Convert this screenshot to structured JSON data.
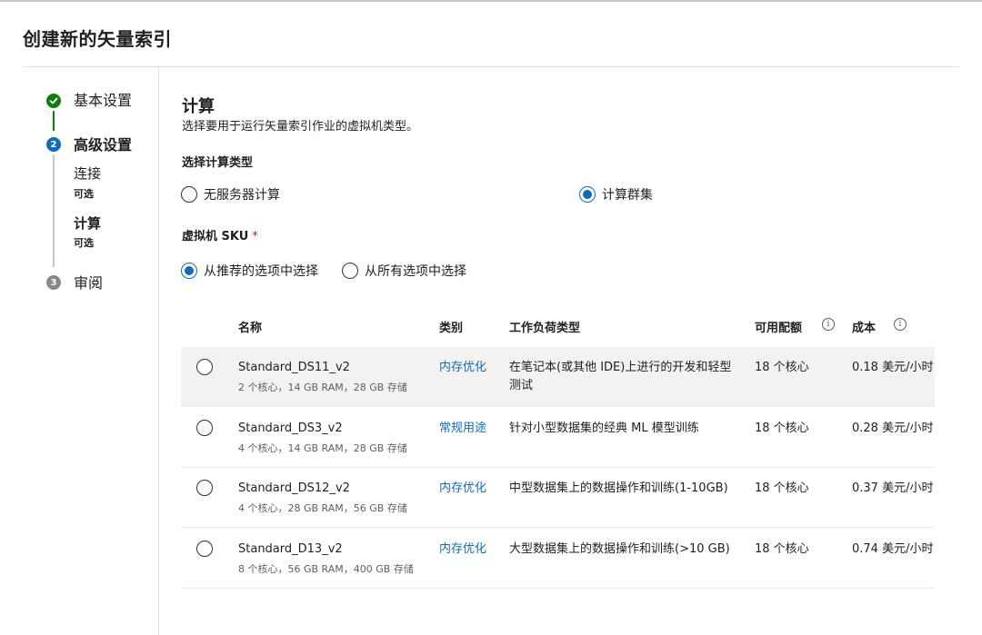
{
  "title": "创建新的矢量索引",
  "stepper": {
    "steps": [
      {
        "number": "✓",
        "label": "基本设置",
        "state": "done"
      },
      {
        "number": "2",
        "label": "高级设置",
        "state": "active"
      },
      {
        "number": "3",
        "label": "审阅",
        "state": "todo"
      }
    ],
    "substeps": [
      {
        "label": "连接",
        "optional": "可选"
      },
      {
        "label": "计算",
        "optional": "可选"
      }
    ]
  },
  "section": {
    "title": "计算",
    "description": "选择要用于运行矢量索引作业的虚拟机类型。"
  },
  "compute_type": {
    "label": "选择计算类型",
    "options": [
      {
        "label": "无服务器计算",
        "selected": false
      },
      {
        "label": "计算群集",
        "selected": true
      }
    ]
  },
  "vm_sku": {
    "label": "虚拟机 SKU",
    "required_mark": "*",
    "options": [
      {
        "label": "从推荐的选项中选择",
        "selected": true
      },
      {
        "label": "从所有选项中选择",
        "selected": false
      }
    ]
  },
  "table": {
    "headers": {
      "name": "名称",
      "category": "类别",
      "workload": "工作负荷类型",
      "quota": "可用配额",
      "cost": "成本"
    },
    "info_icon": "i",
    "rows": [
      {
        "name": "Standard_DS11_v2",
        "spec": "2 个核心，14 GB RAM，28 GB 存储",
        "category": "内存优化",
        "workload": "在笔记本(或其他 IDE)上进行的开发和轻型测试",
        "quota": "18 个核心",
        "cost": "0.18 美元/小时"
      },
      {
        "name": "Standard_DS3_v2",
        "spec": "4 个核心，14 GB RAM，28 GB 存储",
        "category": "常规用途",
        "workload": "针对小型数据集的经典 ML 模型训练",
        "quota": "18 个核心",
        "cost": "0.28 美元/小时"
      },
      {
        "name": "Standard_DS12_v2",
        "spec": "4 个核心，28 GB RAM，56 GB 存储",
        "category": "内存优化",
        "workload": "中型数据集上的数据操作和训练(1-10GB)",
        "quota": "18 个核心",
        "cost": "0.37 美元/小时"
      },
      {
        "name": "Standard_D13_v2",
        "spec": "8 个核心，56 GB RAM，400 GB 存储",
        "category": "内存优化",
        "workload": "大型数据集上的数据操作和训练(>10 GB)",
        "quota": "18 个核心",
        "cost": "0.74 美元/小时"
      }
    ]
  },
  "colors": {
    "accent": "#0f6cbd",
    "success": "#107c10",
    "required": "#a4262c"
  }
}
